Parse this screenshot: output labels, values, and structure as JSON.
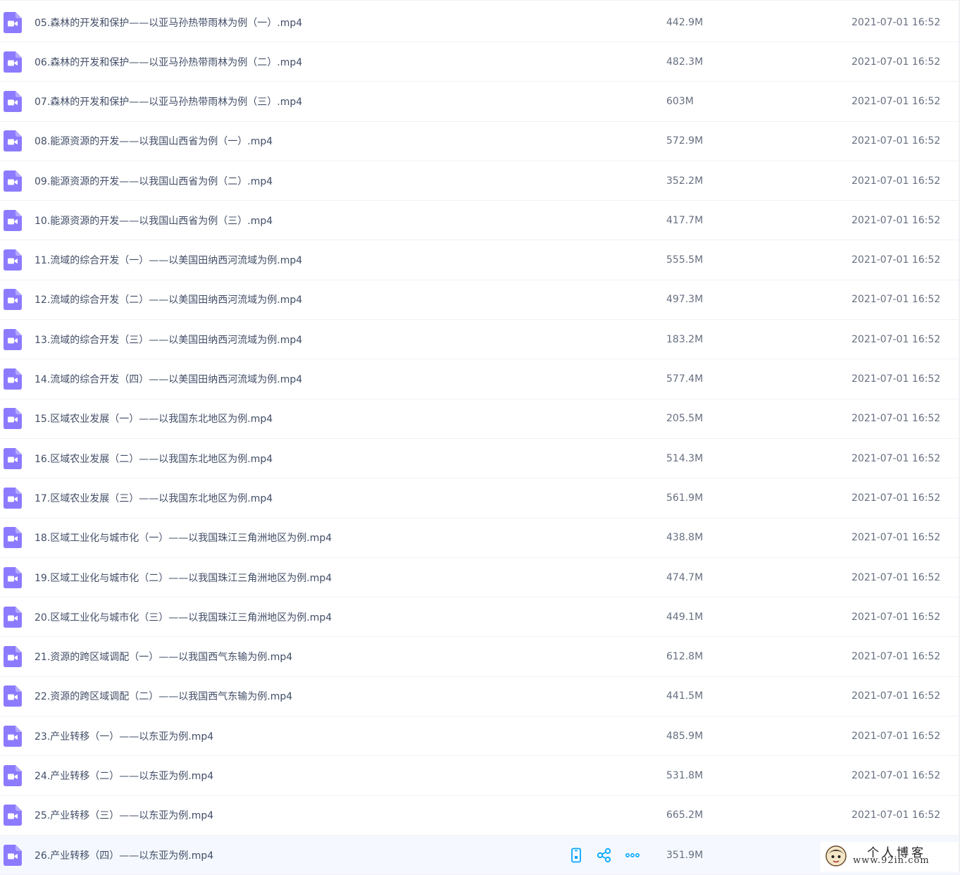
{
  "colors": {
    "file_icon": "#8c7bff",
    "action_icon": "#06a7ff",
    "row_divider": "#f1f2f5",
    "selected_row_bg": "#f5f9ff"
  },
  "file_icon_name": "video-file-icon",
  "files": [
    {
      "name": "05.森林的开发和保护——以亚马孙热带雨林为例（一）.mp4",
      "size": "442.9M",
      "date": "2021-07-01 16:52"
    },
    {
      "name": "06.森林的开发和保护——以亚马孙热带雨林为例（二）.mp4",
      "size": "482.3M",
      "date": "2021-07-01 16:52"
    },
    {
      "name": "07.森林的开发和保护——以亚马孙热带雨林为例（三）.mp4",
      "size": "603M",
      "date": "2021-07-01 16:52"
    },
    {
      "name": "08.能源资源的开发——以我国山西省为例（一）.mp4",
      "size": "572.9M",
      "date": "2021-07-01 16:52"
    },
    {
      "name": "09.能源资源的开发——以我国山西省为例（二）.mp4",
      "size": "352.2M",
      "date": "2021-07-01 16:52"
    },
    {
      "name": "10.能源资源的开发——以我国山西省为例（三）.mp4",
      "size": "417.7M",
      "date": "2021-07-01 16:52"
    },
    {
      "name": "11.流域的综合开发（一）——以美国田纳西河流域为例.mp4",
      "size": "555.5M",
      "date": "2021-07-01 16:52"
    },
    {
      "name": "12.流域的综合开发（二）——以美国田纳西河流域为例.mp4",
      "size": "497.3M",
      "date": "2021-07-01 16:52"
    },
    {
      "name": "13.流域的综合开发（三）——以美国田纳西河流域为例.mp4",
      "size": "183.2M",
      "date": "2021-07-01 16:52"
    },
    {
      "name": "14.流域的综合开发（四）——以美国田纳西河流域为例.mp4",
      "size": "577.4M",
      "date": "2021-07-01 16:52"
    },
    {
      "name": "15.区域农业发展（一）——以我国东北地区为例.mp4",
      "size": "205.5M",
      "date": "2021-07-01 16:52"
    },
    {
      "name": "16.区域农业发展（二）——以我国东北地区为例.mp4",
      "size": "514.3M",
      "date": "2021-07-01 16:52"
    },
    {
      "name": "17.区域农业发展（三）——以我国东北地区为例.mp4",
      "size": "561.9M",
      "date": "2021-07-01 16:52"
    },
    {
      "name": "18.区域工业化与城市化（一）——以我国珠江三角洲地区为例.mp4",
      "size": "438.8M",
      "date": "2021-07-01 16:52"
    },
    {
      "name": "19.区域工业化与城市化（二）——以我国珠江三角洲地区为例.mp4",
      "size": "474.7M",
      "date": "2021-07-01 16:52"
    },
    {
      "name": "20.区域工业化与城市化（三）——以我国珠江三角洲地区为例.mp4",
      "size": "449.1M",
      "date": "2021-07-01 16:52"
    },
    {
      "name": "21.资源的跨区域调配（一）——以我国西气东输为例.mp4",
      "size": "612.8M",
      "date": "2021-07-01 16:52"
    },
    {
      "name": "22.资源的跨区域调配（二）——以我国西气东输为例.mp4",
      "size": "441.5M",
      "date": "2021-07-01 16:52"
    },
    {
      "name": "23.产业转移（一）——以东亚为例.mp4",
      "size": "485.9M",
      "date": "2021-07-01 16:52"
    },
    {
      "name": "24.产业转移（二）——以东亚为例.mp4",
      "size": "531.8M",
      "date": "2021-07-01 16:52"
    },
    {
      "name": "25.产业转移（三）——以东亚为例.mp4",
      "size": "665.2M",
      "date": "2021-07-01 16:52"
    },
    {
      "name": "26.产业转移（四）——以东亚为例.mp4",
      "size": "351.9M",
      "date": "",
      "selected": true,
      "actions": [
        "phone-icon",
        "share-icon",
        "more-icon"
      ]
    }
  ],
  "watermark": {
    "title": "个人博客",
    "url": "www.92in.com"
  }
}
